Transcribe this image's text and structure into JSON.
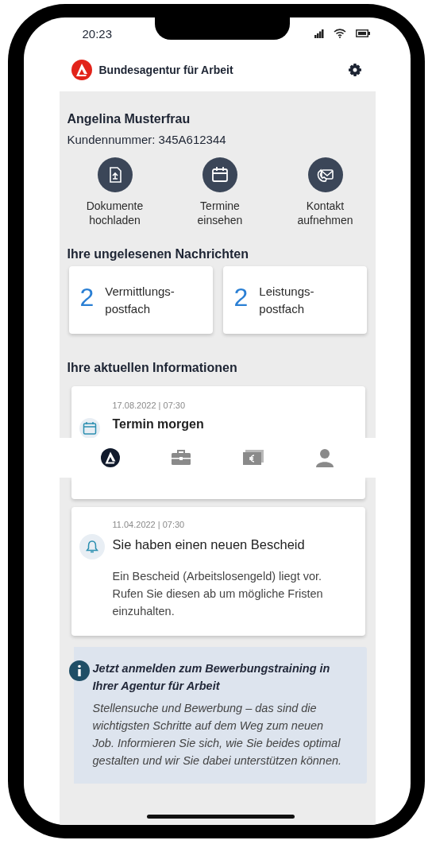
{
  "status_bar": {
    "time": "20:23"
  },
  "header": {
    "title": "Bundesagentur für Arbeit"
  },
  "profile": {
    "name": "Angelina Musterfrau",
    "customer_number": "Kundennummer: 345A612344"
  },
  "quick_actions": [
    {
      "kind": "upload",
      "label": "Dokumente\nhochladen"
    },
    {
      "kind": "calendar",
      "label": "Termine\neinsehen"
    },
    {
      "kind": "contact",
      "label": "Kontakt\naufnehmen"
    }
  ],
  "unread": {
    "heading": "Ihre ungelesenen Nachrichten",
    "mailboxes": [
      {
        "count": "2",
        "label": "Vermittlungs-\npostfach"
      },
      {
        "count": "2",
        "label": "Leistungs-\npostfach"
      }
    ]
  },
  "current_info": {
    "heading": "Ihre aktuellen Informationen",
    "cards": [
      {
        "kind": "appointment",
        "date": "17.08.2022 | 07:30",
        "title": "Termin morgen"
      },
      {
        "kind": "notice",
        "date": "11.04.2022 | 07:30",
        "title": "Sie haben einen neuen Bescheid",
        "body": "Ein Bescheid (Arbeitslosengeld) liegt vor. Rufen Sie diesen ab um mögliche Fristen einzuhalten."
      }
    ]
  },
  "promo": {
    "title": "Jetzt anmelden zum Bewerbungstraining in Ihrer Agentur für Arbeit",
    "body": "Stellensuche und Bewerbung – das sind die wichtigsten Schritte auf dem Weg zum neuen Job. Informieren Sie sich, wie Sie beides optimal gestalten und wir Sie dabei unterstützen können."
  },
  "bottom_nav": [
    {
      "kind": "home",
      "selected": true
    },
    {
      "kind": "jobs",
      "selected": false
    },
    {
      "kind": "money",
      "selected": false
    },
    {
      "kind": "profile",
      "selected": false
    }
  ]
}
